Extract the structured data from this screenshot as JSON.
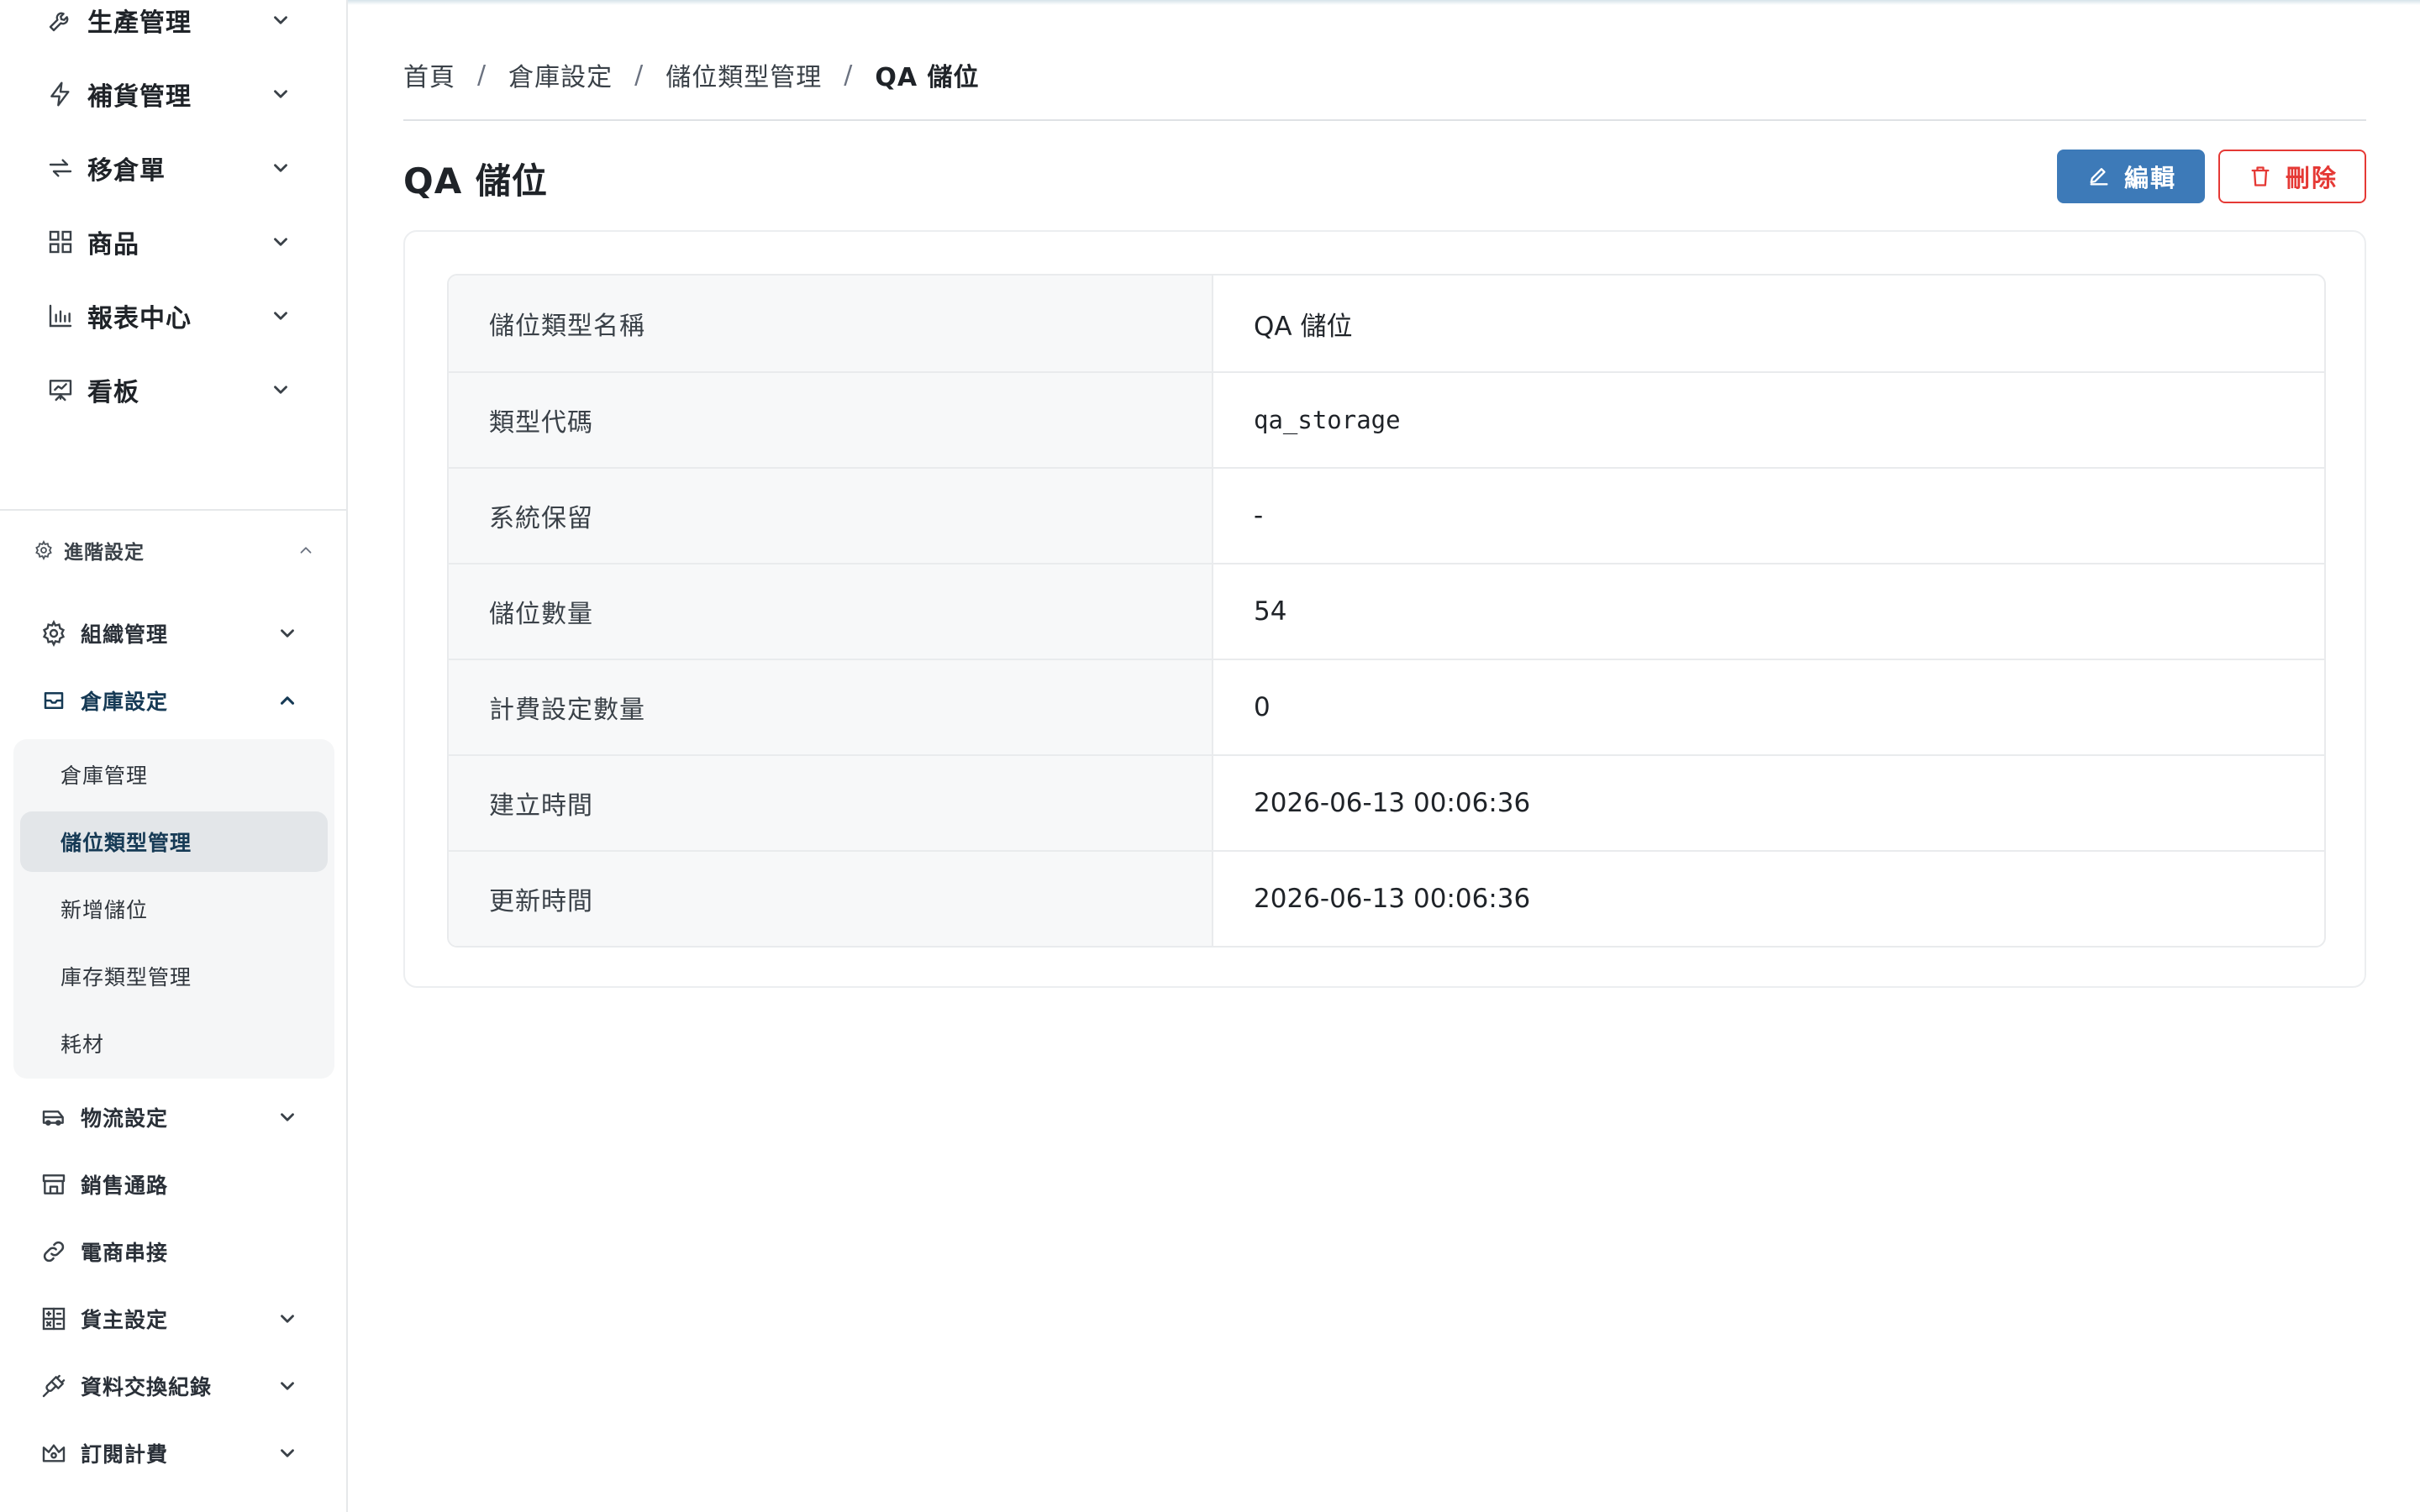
{
  "sidebar": {
    "top_items": [
      {
        "label": "生產管理",
        "icon": "wrench-icon"
      },
      {
        "label": "補貨管理",
        "icon": "lightning-icon"
      },
      {
        "label": "移倉單",
        "icon": "transfer-arrows-icon"
      },
      {
        "label": "商品",
        "icon": "grid-icon"
      },
      {
        "label": "報表中心",
        "icon": "bar-chart-icon"
      },
      {
        "label": "看板",
        "icon": "presentation-icon"
      }
    ],
    "advanced_section": {
      "label": "進階設定",
      "icon": "gear-icon"
    },
    "advanced_items": [
      {
        "label": "組織管理",
        "icon": "cog-icon"
      },
      {
        "label": "倉庫設定",
        "icon": "inbox-icon"
      },
      {
        "label": "物流設定",
        "icon": "truck-icon"
      },
      {
        "label": "銷售通路",
        "icon": "storefront-icon"
      },
      {
        "label": "電商串接",
        "icon": "link-icon"
      },
      {
        "label": "貨主設定",
        "icon": "calculator-icon"
      },
      {
        "label": "資料交換紀錄",
        "icon": "plug-icon"
      },
      {
        "label": "訂閱計費",
        "icon": "crown-icon"
      }
    ],
    "warehouse_sub_items": [
      {
        "label": "倉庫管理"
      },
      {
        "label": "儲位類型管理"
      },
      {
        "label": "新增儲位"
      },
      {
        "label": "庫存類型管理"
      },
      {
        "label": "耗材"
      }
    ]
  },
  "breadcrumb": {
    "home": "首頁",
    "warehouse": "倉庫設定",
    "storage_types": "儲位類型管理",
    "current": "QA 儲位",
    "separator": "/"
  },
  "page": {
    "title": "QA 儲位",
    "edit_label": "編輯",
    "delete_label": "刪除"
  },
  "details": {
    "rows": [
      {
        "label": "儲位類型名稱",
        "value": "QA 儲位"
      },
      {
        "label": "類型代碼",
        "value": "qa_storage"
      },
      {
        "label": "系統保留",
        "value": "-"
      },
      {
        "label": "儲位數量",
        "value": "54"
      },
      {
        "label": "計費設定數量",
        "value": "0"
      },
      {
        "label": "建立時間",
        "value": "2026-06-13 00:06:36"
      },
      {
        "label": "更新時間",
        "value": "2026-06-13 00:06:36"
      }
    ]
  },
  "colors": {
    "primary": "#3d7ab8",
    "danger": "#e53935",
    "active_nav_text": "#163a55"
  }
}
